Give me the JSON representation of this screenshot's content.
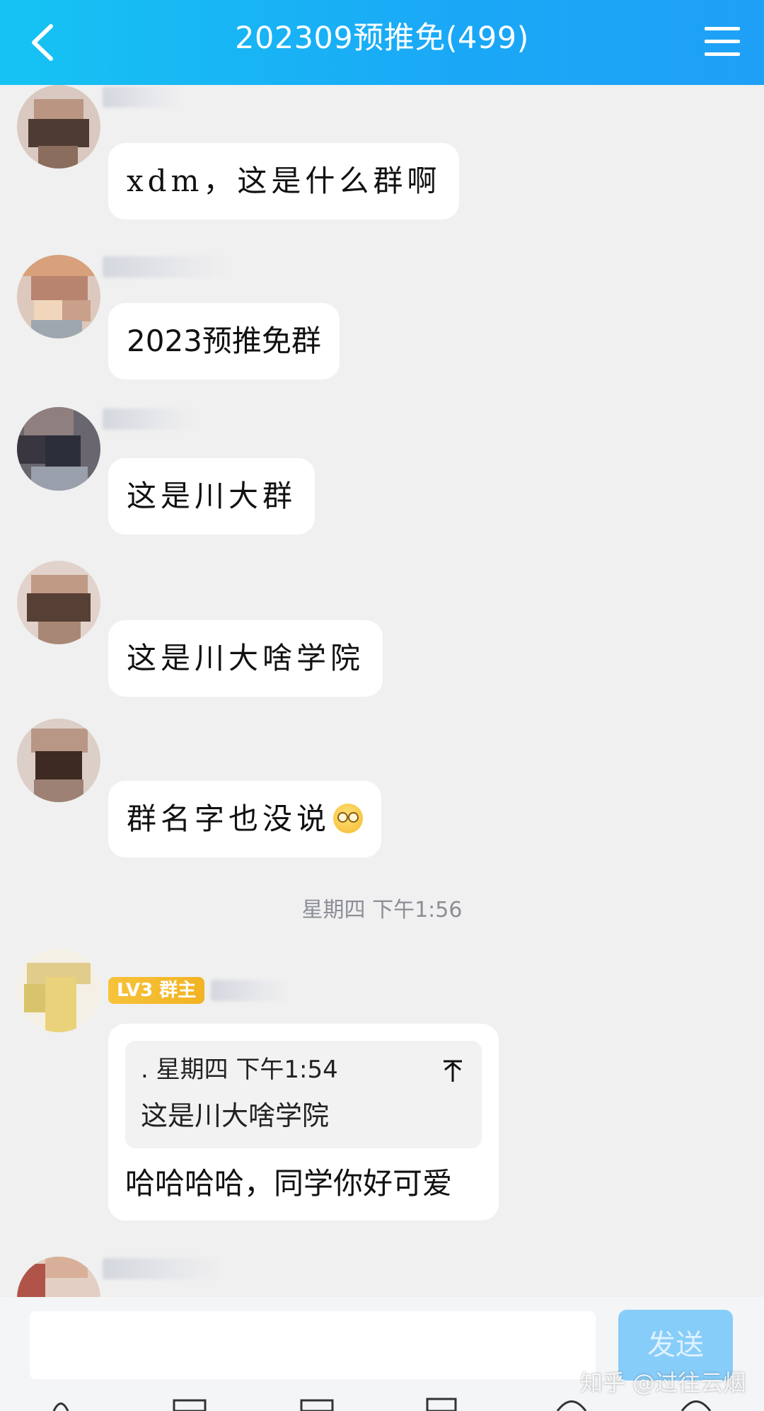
{
  "header": {
    "title": "202309预推免(499)",
    "back_icon": "chevron-left-icon",
    "menu_icon": "hamburger-menu-icon"
  },
  "messages": [
    {
      "text": "xdm，这是什么群啊"
    },
    {
      "text": "2023预推免群"
    },
    {
      "text": "这是川大群"
    },
    {
      "text": "这是川大啥学院"
    },
    {
      "text": "群名字也没说"
    }
  ],
  "time_separator": "星期四 下午1:56",
  "owner_message": {
    "badge": "LV3 群主",
    "quote_header": ". 星期四 下午1:54",
    "quote_text": "这是川大啥学院",
    "text": "哈哈哈哈，同学你好可爱"
  },
  "input": {
    "placeholder": "",
    "send_label": "发送"
  },
  "watermark": "知乎 @过往云烟"
}
